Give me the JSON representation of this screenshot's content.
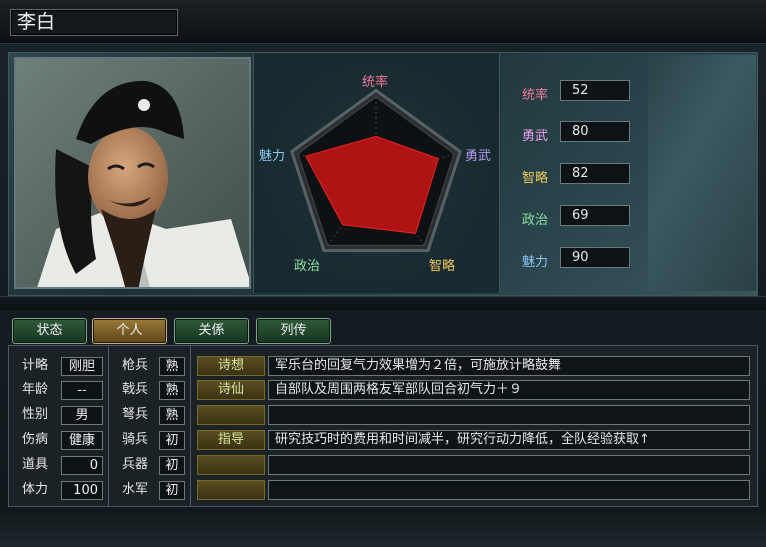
{
  "character": {
    "name": "李白"
  },
  "radar": {
    "labels": {
      "leadership": "统率",
      "war": "勇武",
      "intelligence": "智略",
      "politics": "政治",
      "charisma": "魅力"
    },
    "values": {
      "leadership": 52,
      "war": 80,
      "intelligence": 82,
      "politics": 69,
      "charisma": 90
    },
    "max": 100,
    "colors": {
      "fill": "#c01515",
      "leadership": "#f07a9a",
      "war": "#b59bf0",
      "intelligence": "#f0c95a",
      "politics": "#8ae0a0",
      "charisma": "#8ac6f0"
    }
  },
  "stats": [
    {
      "label": "统率",
      "value": "52",
      "color": "#f07a9a"
    },
    {
      "label": "勇武",
      "value": "80",
      "color": "#f0a0f0"
    },
    {
      "label": "智略",
      "value": "82",
      "color": "#f0c95a"
    },
    {
      "label": "政治",
      "value": "69",
      "color": "#8ae0a0"
    },
    {
      "label": "魅力",
      "value": "90",
      "color": "#8ac6f0"
    }
  ],
  "tabs": [
    {
      "label": "状态",
      "active": false
    },
    {
      "label": "个人",
      "active": true
    },
    {
      "label": "关係",
      "active": false
    },
    {
      "label": "列传",
      "active": false
    }
  ],
  "attributes": [
    {
      "label": "计略",
      "value": "刚胆"
    },
    {
      "label": "年龄",
      "value": "--"
    },
    {
      "label": "性别",
      "value": "男"
    },
    {
      "label": "伤病",
      "value": "健康"
    },
    {
      "label": "道具",
      "value": "0"
    },
    {
      "label": "体力",
      "value": "100"
    }
  ],
  "aptitudes": [
    {
      "label": "枪兵",
      "value": "熟"
    },
    {
      "label": "戟兵",
      "value": "熟"
    },
    {
      "label": "弩兵",
      "value": "熟"
    },
    {
      "label": "骑兵",
      "value": "初"
    },
    {
      "label": "兵器",
      "value": "初"
    },
    {
      "label": "水军",
      "value": "初"
    }
  ],
  "skills": [
    {
      "name": "诗想",
      "desc": "军乐台的回复气力效果增为２倍，可施放计略鼓舞"
    },
    {
      "name": "诗仙",
      "desc": "自部队及周围两格友军部队回合初气力＋９"
    },
    {
      "name": "",
      "desc": ""
    },
    {
      "name": "指导",
      "desc": "研究技巧时的费用和时间减半，研究行动力降低，全队经验获取↑"
    },
    {
      "name": "",
      "desc": ""
    },
    {
      "name": "",
      "desc": ""
    }
  ]
}
